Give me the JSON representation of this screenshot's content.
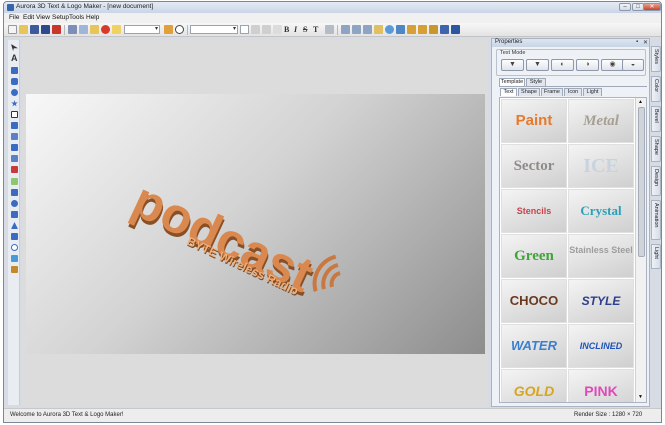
{
  "window": {
    "title": "Aurora 3D Text & Logo Maker - [new document]",
    "controls": {
      "minimize": "–",
      "maximize": "□",
      "close": "✕"
    }
  },
  "menu": [
    "File",
    "Edit",
    "View",
    "Setup",
    "Tools",
    "Help"
  ],
  "toolbar": {
    "font_size": "",
    "bold": "B",
    "italic": "I",
    "strike": "S",
    "strike2": "T"
  },
  "canvas": {
    "main_text": "podcast",
    "sub_text": "BYTE Wireless Radio",
    "text_color": "#d9894f"
  },
  "properties": {
    "title": "Properties",
    "text_mode_label": "Text Mode",
    "tabs": [
      "Template",
      "Style"
    ],
    "subtabs": [
      "Text",
      "Shape",
      "Frame",
      "Icon",
      "Light"
    ],
    "templates": [
      {
        "label": "Paint",
        "color": "#e8782a"
      },
      {
        "label": "Metal",
        "color": "#a79f93"
      },
      {
        "label": "Sector",
        "color": "#8f8c88"
      },
      {
        "label": "ICE",
        "color": "#c9d3df"
      },
      {
        "label": "Stencils",
        "color": "#c9434a"
      },
      {
        "label": "Crystal",
        "color": "#2a9fb8"
      },
      {
        "label": "Green",
        "color": "#3fa53a"
      },
      {
        "label": "Stainless Steel",
        "color": "#9d9d9d"
      },
      {
        "label": "CHOCO",
        "color": "#6a3a1f"
      },
      {
        "label": "STYLE",
        "color": "#2d3e8c"
      },
      {
        "label": "WATER",
        "color": "#3a7fd0"
      },
      {
        "label": "INCLINED",
        "color": "#1f54b8"
      },
      {
        "label": "GOLD",
        "color": "#d8a51f"
      },
      {
        "label": "PINK",
        "color": "#e04ab8"
      }
    ],
    "side_tabs": [
      "Styles",
      "Color",
      "Bevel",
      "Shape",
      "Design",
      "Animation",
      "Light"
    ]
  },
  "status": {
    "message": "Welcome to Aurora 3D Text & Logo Maker!",
    "render_size": "Render Size : 1280 × 720"
  }
}
